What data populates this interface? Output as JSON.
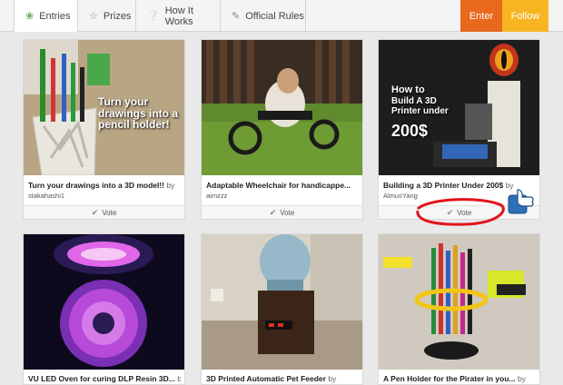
{
  "nav": {
    "tabs": [
      {
        "label": "Entries",
        "icon": "leaf-icon"
      },
      {
        "label": "Prizes",
        "icon": "trophy-icon"
      },
      {
        "label": "How It Works",
        "icon": "question-icon"
      },
      {
        "label": "Official Rules",
        "icon": "pencil-icon"
      }
    ],
    "enter_label": "Enter",
    "follow_label": "Follow"
  },
  "entries": [
    {
      "title": "Turn your drawings into a 3D model!!",
      "by": "by",
      "author": "stakahashi1",
      "vote": "Vote",
      "overlay": "Turn your drawings into a pencil holder!"
    },
    {
      "title": "Adaptable Wheelchair for handicappe...",
      "by": "",
      "author": "aimzzz",
      "vote": "Vote"
    },
    {
      "title": "Building a 3D Printer Under 200$",
      "by": "by",
      "author": "AlmusYang",
      "vote": "Vote",
      "overlay_1": "How to",
      "overlay_2": "Build A 3D Printer under",
      "overlay_3": "200$"
    },
    {
      "title": "VU LED Oven for curing DLP Resin 3D...",
      "by": "by",
      "author": ""
    },
    {
      "title": "3D Printed Automatic Pet Feeder",
      "by": "by",
      "author": ""
    },
    {
      "title": "A Pen Holder for the Pirater in you...",
      "by": "by",
      "author": ""
    }
  ],
  "colors": {
    "enter": "#e8681e",
    "follow": "#f7b521",
    "annotation": "#e0141c"
  }
}
